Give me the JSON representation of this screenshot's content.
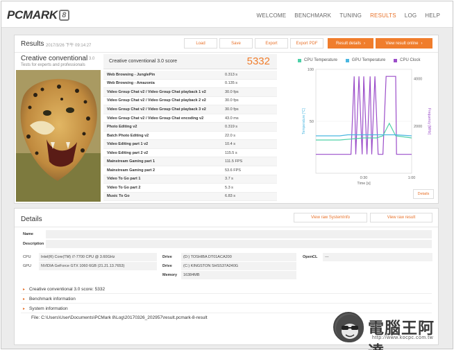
{
  "app": {
    "logo_text": "PCMARK",
    "logo_version": "8"
  },
  "nav": {
    "items": [
      "WELCOME",
      "BENCHMARK",
      "TUNING",
      "RESULTS",
      "LOG",
      "HELP"
    ],
    "active": "RESULTS"
  },
  "results": {
    "title": "Results",
    "date": "2017/3/26 下午 09:14:27",
    "buttons": {
      "load": "Load",
      "save": "Save",
      "export": "Export",
      "export_pdf": "Export PDF",
      "result_details": "Result details",
      "view_online": "View result online"
    },
    "benchmark_name": "Creative conventional",
    "benchmark_version": "3.0",
    "benchmark_subtitle": "Tests for experts and professionals",
    "score_label": "Creative conventional 3.0 score",
    "score_value": "5332",
    "rows": [
      {
        "name": "Web Browsing - JunglePin",
        "value": "0.313 s"
      },
      {
        "name": "Web Browsing - Amazonia",
        "value": "0.135 s"
      },
      {
        "name": "Video Group Chat v2 / Video Group Chat playback 1 v2",
        "value": "30.0 fps"
      },
      {
        "name": "Video Group Chat v2 / Video Group Chat playback 2 v2",
        "value": "30.0 fps"
      },
      {
        "name": "Video Group Chat v2 / Video Group Chat playback 3 v2",
        "value": "30.0 fps"
      },
      {
        "name": "Video Group Chat v2 / Video Group Chat encoding v2",
        "value": "43.0 ms"
      },
      {
        "name": "Photo Editing v2",
        "value": "0.319 s"
      },
      {
        "name": "Batch Photo Editing v2",
        "value": "22.0 s"
      },
      {
        "name": "Video Editing part 1 v2",
        "value": "10.4 s"
      },
      {
        "name": "Video Editing part 2 v2",
        "value": "115.5 s"
      },
      {
        "name": "Mainstream Gaming part 1",
        "value": "111.5 FPS"
      },
      {
        "name": "Mainstream Gaming part 2",
        "value": "53.6 FPS"
      },
      {
        "name": "Video To Go part 1",
        "value": "3.7 s"
      },
      {
        "name": "Video To Go part 2",
        "value": "5.3 s"
      },
      {
        "name": "Music To Go",
        "value": "6.83 s"
      }
    ],
    "details_button": "Details"
  },
  "chart_data": {
    "type": "line",
    "legend": [
      {
        "name": "CPU Temperature",
        "color": "#4dd0a8"
      },
      {
        "name": "GPU Temperature",
        "color": "#49b6e0"
      },
      {
        "name": "CPU Clock",
        "color": "#9b4dc9"
      }
    ],
    "xlabel": "Time [s]",
    "ylabel_left": "Temperature [°C]",
    "ylabel_right": "Frequency [MHz]",
    "x_ticks": [
      "0:30",
      "1:00"
    ],
    "y_left_ticks": [
      "100",
      "50"
    ],
    "y_right_ticks": [
      "4000",
      "2000"
    ],
    "ylim_left": [
      0,
      100
    ],
    "ylim_right": [
      0,
      4400
    ],
    "xlim": [
      0,
      60
    ],
    "series": [
      {
        "name": "CPU Clock",
        "axis": "right",
        "color": "#9b4dc9",
        "x": [
          0,
          15,
          17,
          22,
          24,
          25,
          27,
          29,
          30,
          32,
          34,
          35,
          37,
          39,
          40,
          42,
          44,
          44.5,
          45,
          50,
          50.5,
          60
        ],
        "y": [
          800,
          800,
          800,
          800,
          4100,
          800,
          4100,
          800,
          4100,
          800,
          4100,
          800,
          4100,
          800,
          800,
          800,
          4100,
          4100,
          4100,
          4100,
          800,
          800
        ]
      },
      {
        "name": "CPU Temperature",
        "axis": "left",
        "color": "#4dd0a8",
        "x": [
          0,
          15,
          30,
          38,
          42,
          44,
          46,
          50,
          60
        ],
        "y": [
          32,
          32,
          34,
          34,
          36,
          42,
          48,
          36,
          34
        ]
      },
      {
        "name": "GPU Temperature",
        "axis": "left",
        "color": "#49b6e0",
        "x": [
          0,
          15,
          20,
          40,
          50,
          60
        ],
        "y": [
          36,
          36,
          37,
          37,
          37,
          36
        ]
      }
    ]
  },
  "details": {
    "title": "Details",
    "view_sysinfo": "View raw SystemInfo",
    "view_result": "View raw result",
    "name_label": "Name",
    "desc_label": "Description",
    "cpu_label": "CPU",
    "cpu_value": "Intel(R) Core(TM) i7-7700 CPU @ 3.60GHz",
    "gpu_label": "GPU",
    "gpu_value": "NVIDIA GeForce GTX 1060 6GB (21.21.13.7653)",
    "drive_label": "Drive",
    "drive1_value": "(D:) TOSHIBA DT01ACA200",
    "drive2_value": "(C:) KINGSTON SHSS37A240G",
    "memory_label": "Memory",
    "memory_value": "16384MB",
    "opencl_label": "OpenCL",
    "opencl_value": "---",
    "expand_items": [
      "Creative conventional 3.0 score: 5332",
      "Benchmark information",
      "System information"
    ],
    "file_line": "File: C:\\Users\\User\\Documents\\PCMark 8\\Log\\20170326_202957\\result.pcmark-8-result"
  },
  "watermark": {
    "text": "電腦王阿達",
    "url": "http://www.kocpc.com.tw"
  }
}
